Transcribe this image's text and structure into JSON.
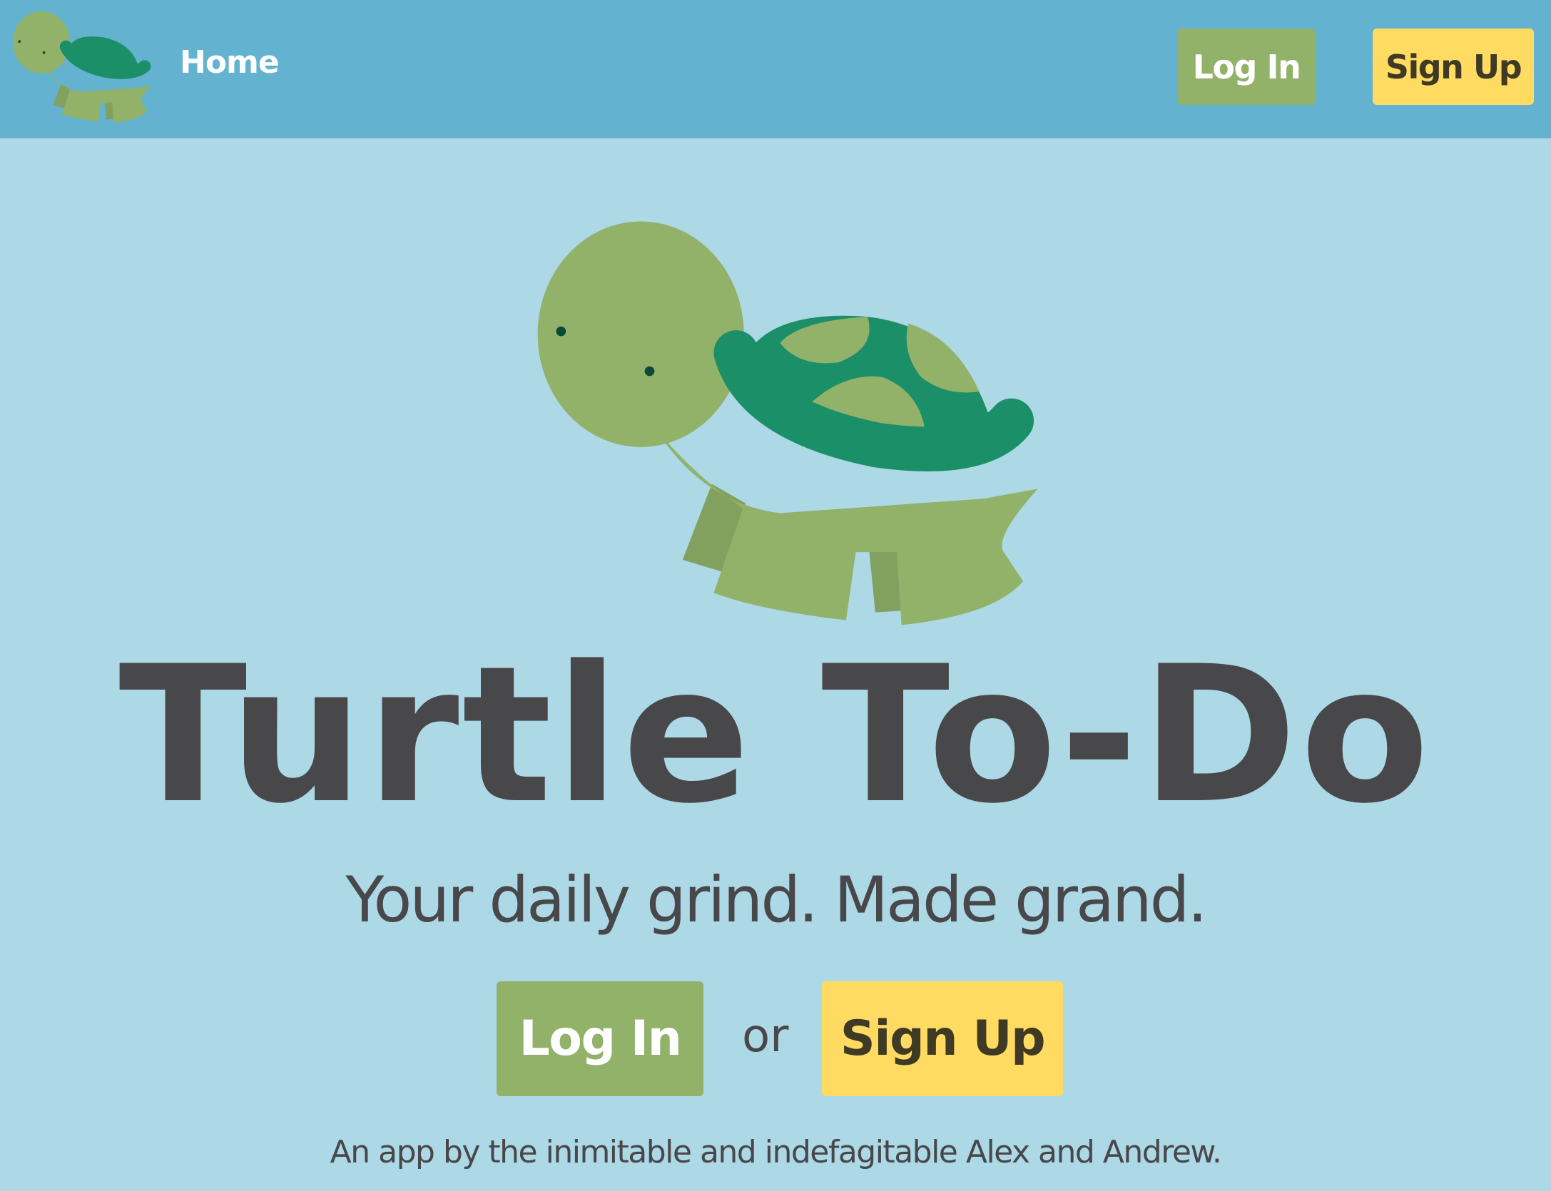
{
  "navbar": {
    "logo_icon": "turtle-logo-icon",
    "home_label": "Home",
    "login_label": "Log In",
    "signup_label": "Sign Up",
    "background": "#63b2cf"
  },
  "hero": {
    "illustration_icon": "turtle-illustration-icon",
    "title": "Turtle To-Do",
    "subtitle": "Your daily grind. Made grand.",
    "login_label": "Log In",
    "or_text": "or",
    "signup_label": "Sign Up"
  },
  "footer": {
    "credit": "An app by the inimitable and indefagitable Alex and Andrew."
  },
  "colors": {
    "page_background": "#add8e6",
    "login_button": "#92b169",
    "signup_button": "#ffdb62",
    "text_dark": "#484749",
    "turtle_body": "#92b169",
    "turtle_shell": "#1a8f68"
  }
}
